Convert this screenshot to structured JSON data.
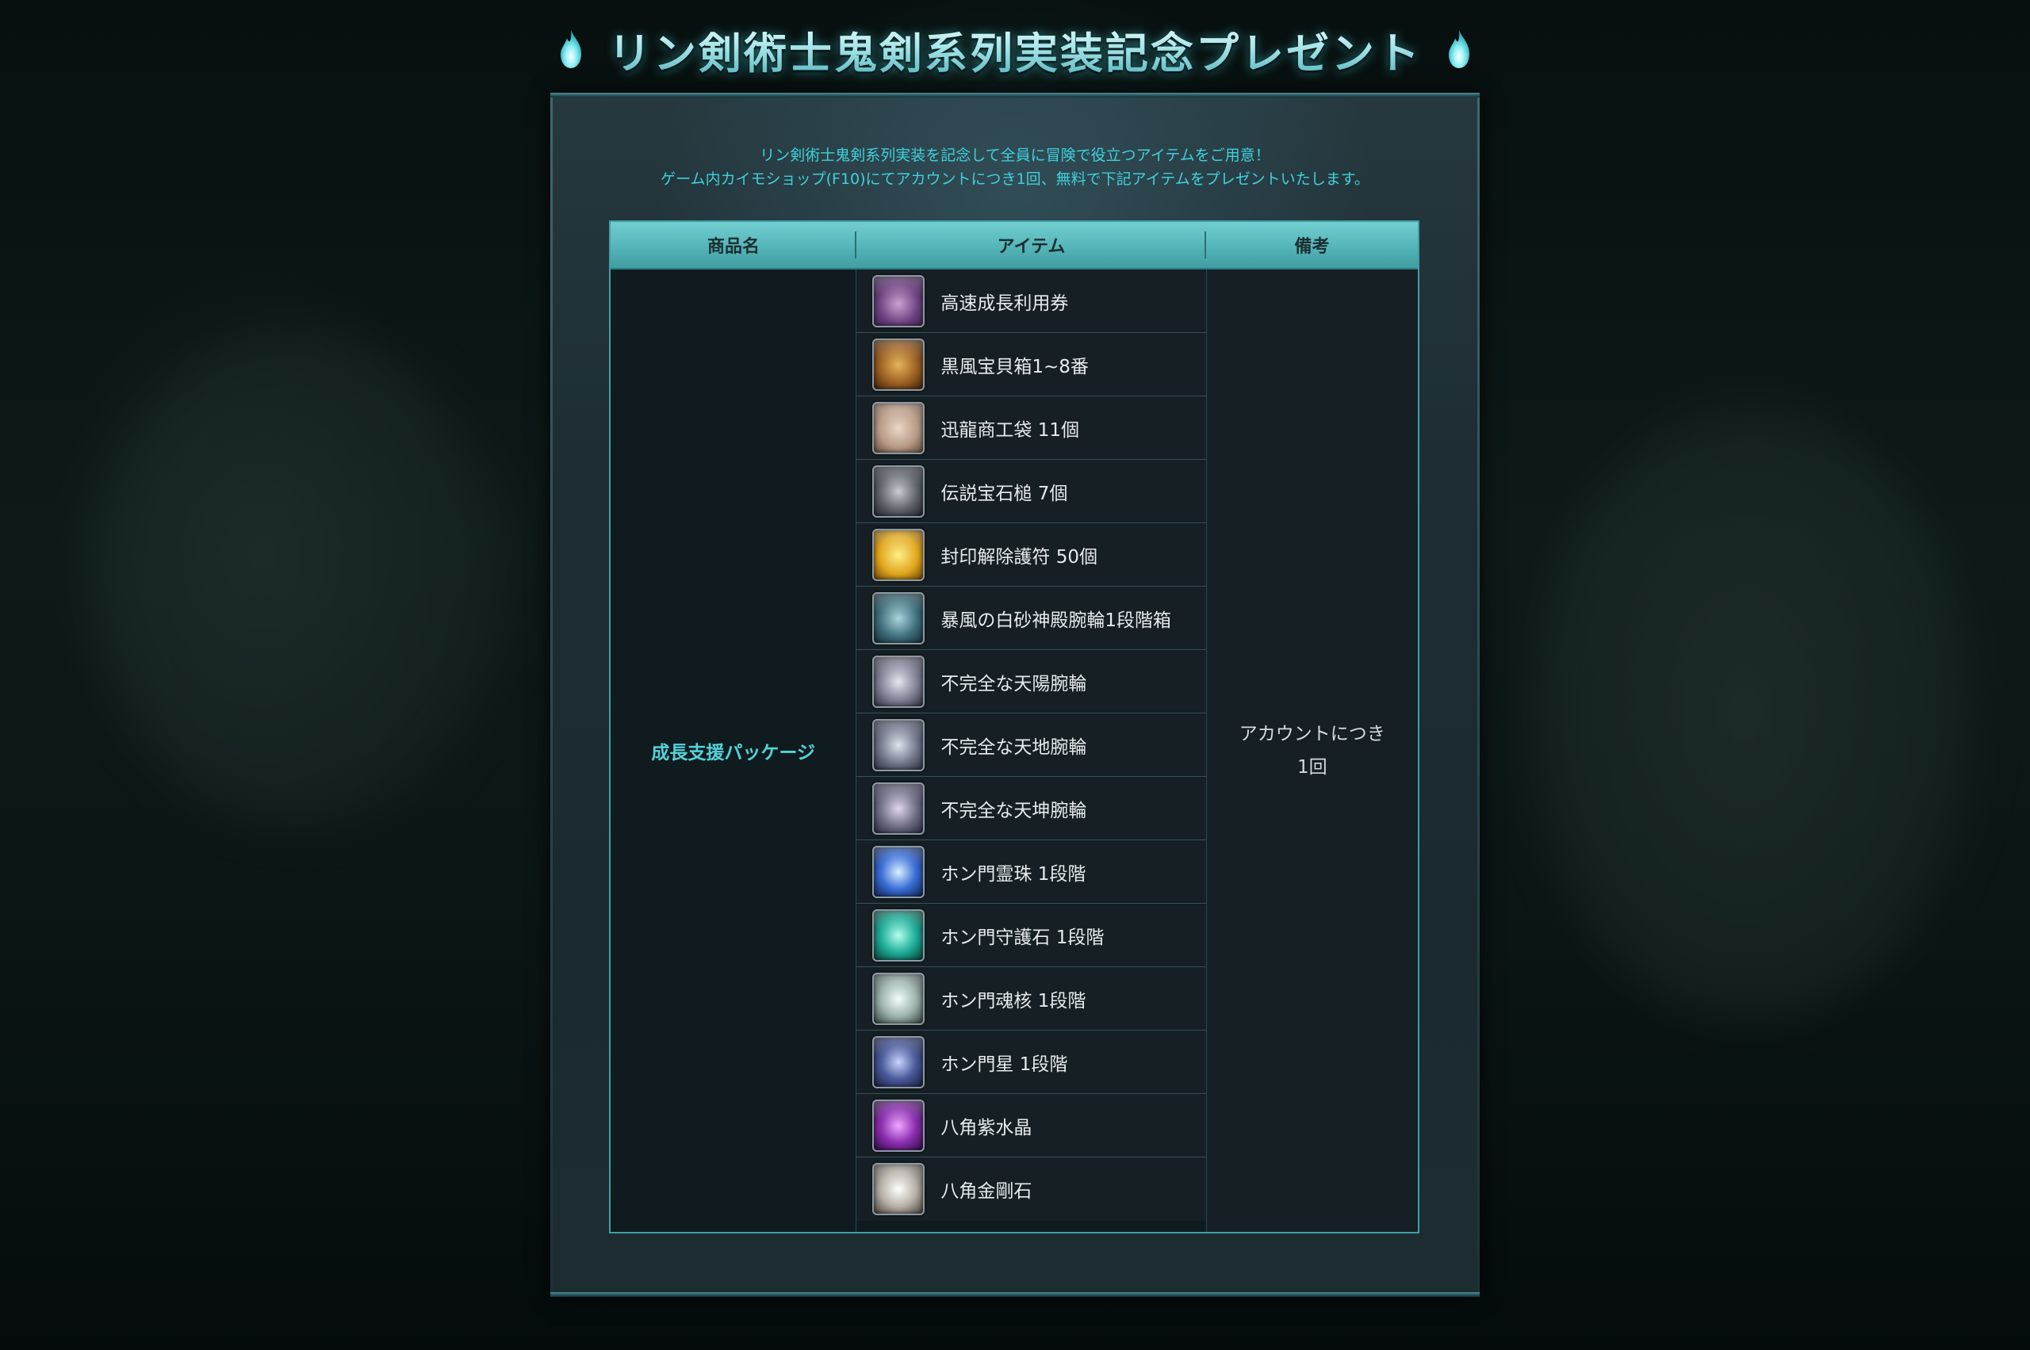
{
  "header": {
    "title": "リン剣術士鬼剣系列実装記念プレゼント",
    "flame_icon": "blue-flame-icon"
  },
  "intro": {
    "line1": "リン剣術士鬼剣系列実装を記念して全員に冒険で役立つアイテムをご用意！",
    "line2": "ゲーム内カイモショップ(F10)にてアカウントにつき1回、無料で下記アイテムをプレゼントいたします。"
  },
  "table": {
    "headers": {
      "name": "商品名",
      "item": "アイテム",
      "note": "備考"
    },
    "product_name": "成長支援パッケージ",
    "note": {
      "line1": "アカウントにつき",
      "line2": "1回"
    },
    "items": [
      {
        "name": "高速成長利用券",
        "icon": "growth-ticket-icon",
        "color": "#5a3a6e"
      },
      {
        "name": "黒風宝貝箱1~8番",
        "icon": "treasure-box-icon",
        "color": "#8a5a2a"
      },
      {
        "name": "迅龍商工袋 11個",
        "icon": "merchant-bag-icon",
        "color": "#b89a86"
      },
      {
        "name": "伝説宝石槌 7個",
        "icon": "gem-hammer-icon",
        "color": "#4a4f56"
      },
      {
        "name": "封印解除護符 50個",
        "icon": "seal-charm-icon",
        "color": "#d9a520"
      },
      {
        "name": "暴風の白砂神殿腕輪1段階箱",
        "icon": "bracelet-box-icon",
        "color": "#3d6d7a"
      },
      {
        "name": "不完全な天陽腕輪",
        "icon": "sun-bracelet-icon",
        "color": "#7d7f92"
      },
      {
        "name": "不完全な天地腕輪",
        "icon": "earth-bracelet-icon",
        "color": "#6f7488"
      },
      {
        "name": "不完全な天坤腕輪",
        "icon": "kun-bracelet-icon",
        "color": "#6a6a82"
      },
      {
        "name": "ホン門霊珠 1段階",
        "icon": "spirit-orb-icon",
        "color": "#3a6ed6"
      },
      {
        "name": "ホン門守護石 1段階",
        "icon": "guardian-stone-icon",
        "color": "#1fae9a"
      },
      {
        "name": "ホン門魂核 1段階",
        "icon": "soul-core-icon",
        "color": "#9fb4b0"
      },
      {
        "name": "ホン門星 1段階",
        "icon": "star-icon",
        "color": "#4a5a9a"
      },
      {
        "name": "八角紫水晶",
        "icon": "amethyst-icon",
        "color": "#8a2fb0"
      },
      {
        "name": "八角金剛石",
        "icon": "diamond-icon",
        "color": "#b8b2a8"
      }
    ]
  }
}
